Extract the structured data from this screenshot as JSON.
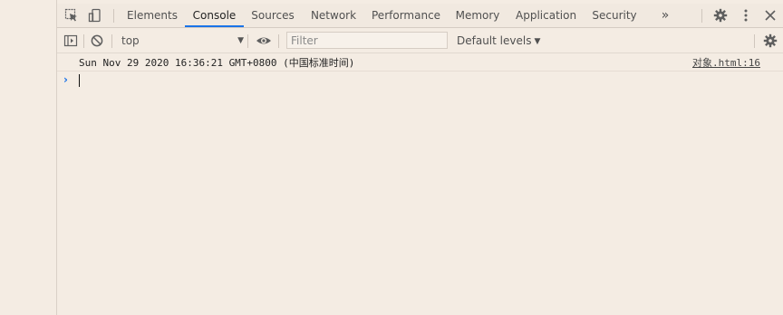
{
  "tabs": [
    {
      "label": "Elements"
    },
    {
      "label": "Console"
    },
    {
      "label": "Sources"
    },
    {
      "label": "Network"
    },
    {
      "label": "Performance"
    },
    {
      "label": "Memory"
    },
    {
      "label": "Application"
    },
    {
      "label": "Security"
    }
  ],
  "active_tab": "Console",
  "more_tabs_label": "»",
  "toolbar": {
    "context": "top",
    "filter_placeholder": "Filter",
    "levels": "Default levels"
  },
  "console": {
    "messages": [
      {
        "text": "Sun Nov 29 2020 16:36:21 GMT+0800 (中国标准时间)",
        "source": "对象.html:16"
      }
    ],
    "prompt": "›"
  },
  "icons": {
    "inspect": "inspect-element-icon",
    "device": "device-toolbar-icon",
    "settings": "gear-icon",
    "menu": "kebab-menu-icon",
    "close": "close-icon",
    "sidebar": "show-sidebar-icon",
    "clear": "clear-console-icon",
    "eye": "eye-icon"
  },
  "colors": {
    "background": "#f4ece3",
    "active_tab_underline": "#1a73e8"
  }
}
